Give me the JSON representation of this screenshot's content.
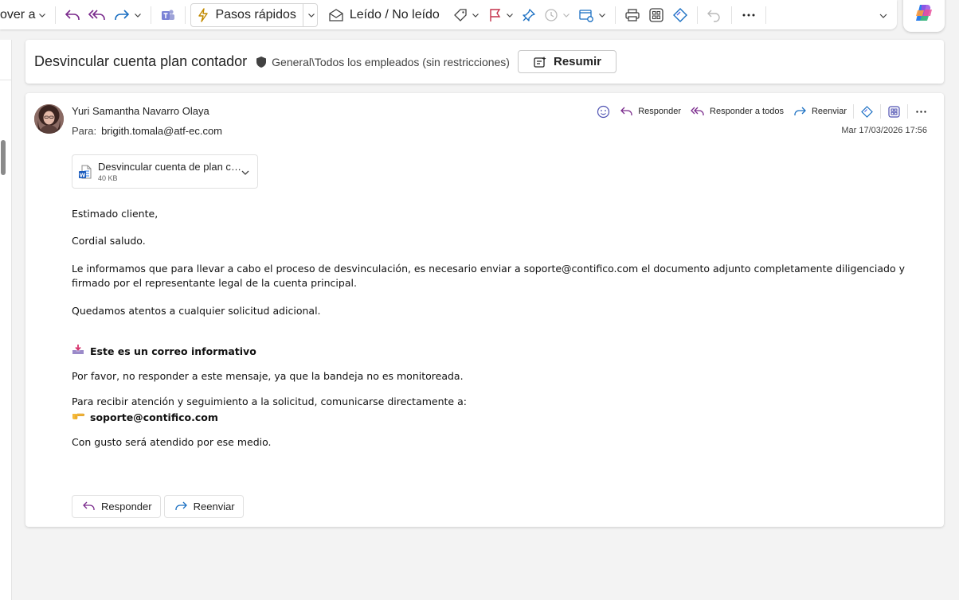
{
  "toolbar": {
    "move_label": "over a",
    "quick_steps_label": "Pasos rápidos",
    "read_unread_label": "Leído / No leído"
  },
  "subject_bar": {
    "subject": "Desvincular cuenta plan contador",
    "sensitivity": "General\\Todos los empleados (sin restricciones)",
    "summarize_label": "Resumir"
  },
  "message": {
    "sender": "Yuri Samantha Navarro Olaya",
    "to_label": "Para:",
    "to_address": "brigith.tomala@atf-ec.com",
    "date": "Mar 17/03/2026 17:56",
    "actions": {
      "reply": "Responder",
      "reply_all": "Responder a todos",
      "forward": "Reenviar"
    },
    "attachment": {
      "name": "Desvincular cuenta de plan contador",
      "size": "40 KB"
    },
    "body": {
      "greeting": "Estimado cliente,",
      "salute": "Cordial saludo.",
      "paragraph": "Le informamos que para llevar a cabo el proceso de desvinculación, es necesario enviar a soporte@contifico.com el documento adjunto completamente diligenciado y firmado por el representante legal de la cuenta principal.",
      "closing": "Quedamos atentos a cualquier solicitud adicional.",
      "notice_title": "Este es un correo informativo",
      "notice_text": "Por favor, no responder a este mensaje, ya que la bandeja no es monitoreada.",
      "contact_text": "Para recibir atención y seguimiento a la solicitud, comunicarse directamente a:",
      "contact_email": "soporte@contifico.com",
      "final": "Con gusto será atendido por ese medio."
    },
    "footer_buttons": {
      "reply": "Responder",
      "forward": "Reenviar"
    }
  }
}
